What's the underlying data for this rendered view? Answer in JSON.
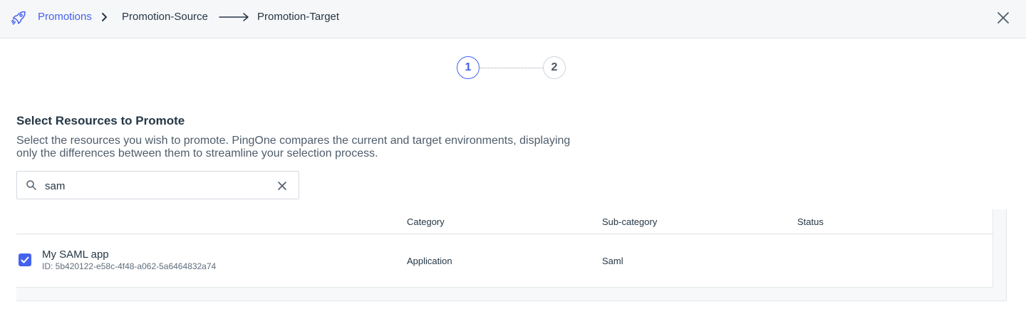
{
  "header": {
    "icon": "rocket-icon",
    "breadcrumb_link": "Promotions",
    "source": "Promotion-Source",
    "target": "Promotion-Target",
    "close_icon": "close-icon",
    "accent_color": "#4462ed"
  },
  "stepper": {
    "steps": [
      {
        "label": "1",
        "state": "active"
      },
      {
        "label": "2",
        "state": "inactive"
      }
    ]
  },
  "section": {
    "title": "Select Resources to Promote",
    "description": "Select the resources you wish to promote. PingOne compares the current and target environments, displaying only the differences between them to streamline your selection process."
  },
  "search": {
    "icon": "search-icon",
    "value": "sam",
    "clear_icon": "clear-icon"
  },
  "table": {
    "columns": [
      "",
      "Category",
      "Sub-category",
      "Status"
    ],
    "rows": [
      {
        "checked": true,
        "name": "My SAML app",
        "id": "ID: 5b420122-e58c-4f48-a062-5a6464832a74",
        "category": "Application",
        "subcategory": "Saml",
        "status": ""
      }
    ]
  }
}
